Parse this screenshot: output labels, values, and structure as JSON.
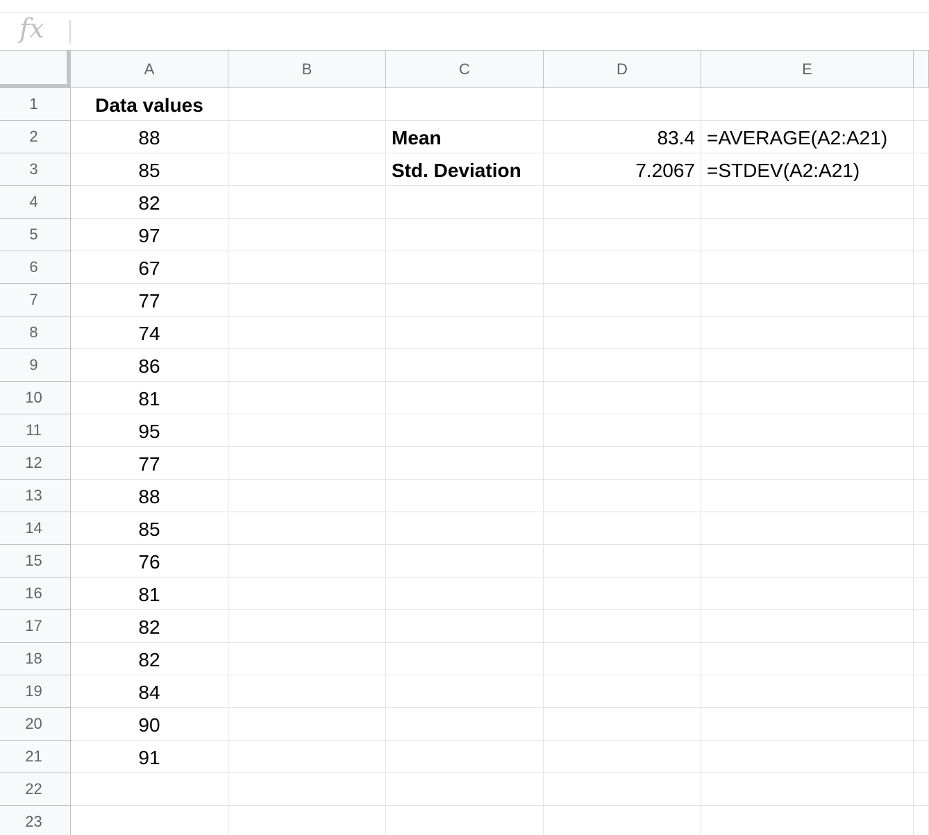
{
  "formula_bar": {
    "icon": "fx",
    "value": ""
  },
  "columns": [
    "A",
    "B",
    "C",
    "D",
    "E"
  ],
  "rows": [
    {
      "num": "1",
      "A": "Data values",
      "B": "",
      "C": "",
      "D": "",
      "E": ""
    },
    {
      "num": "2",
      "A": "88",
      "B": "",
      "C": "Mean",
      "D": "83.4",
      "E": "=AVERAGE(A2:A21)"
    },
    {
      "num": "3",
      "A": "85",
      "B": "",
      "C": "Std. Deviation",
      "D": "7.2067",
      "E": "=STDEV(A2:A21)"
    },
    {
      "num": "4",
      "A": "82",
      "B": "",
      "C": "",
      "D": "",
      "E": ""
    },
    {
      "num": "5",
      "A": "97",
      "B": "",
      "C": "",
      "D": "",
      "E": ""
    },
    {
      "num": "6",
      "A": "67",
      "B": "",
      "C": "",
      "D": "",
      "E": ""
    },
    {
      "num": "7",
      "A": "77",
      "B": "",
      "C": "",
      "D": "",
      "E": ""
    },
    {
      "num": "8",
      "A": "74",
      "B": "",
      "C": "",
      "D": "",
      "E": ""
    },
    {
      "num": "9",
      "A": "86",
      "B": "",
      "C": "",
      "D": "",
      "E": ""
    },
    {
      "num": "10",
      "A": "81",
      "B": "",
      "C": "",
      "D": "",
      "E": ""
    },
    {
      "num": "11",
      "A": "95",
      "B": "",
      "C": "",
      "D": "",
      "E": ""
    },
    {
      "num": "12",
      "A": "77",
      "B": "",
      "C": "",
      "D": "",
      "E": ""
    },
    {
      "num": "13",
      "A": "88",
      "B": "",
      "C": "",
      "D": "",
      "E": ""
    },
    {
      "num": "14",
      "A": "85",
      "B": "",
      "C": "",
      "D": "",
      "E": ""
    },
    {
      "num": "15",
      "A": "76",
      "B": "",
      "C": "",
      "D": "",
      "E": ""
    },
    {
      "num": "16",
      "A": "81",
      "B": "",
      "C": "",
      "D": "",
      "E": ""
    },
    {
      "num": "17",
      "A": "82",
      "B": "",
      "C": "",
      "D": "",
      "E": ""
    },
    {
      "num": "18",
      "A": "82",
      "B": "",
      "C": "",
      "D": "",
      "E": ""
    },
    {
      "num": "19",
      "A": "84",
      "B": "",
      "C": "",
      "D": "",
      "E": ""
    },
    {
      "num": "20",
      "A": "90",
      "B": "",
      "C": "",
      "D": "",
      "E": ""
    },
    {
      "num": "21",
      "A": "91",
      "B": "",
      "C": "",
      "D": "",
      "E": ""
    },
    {
      "num": "22",
      "A": "",
      "B": "",
      "C": "",
      "D": "",
      "E": ""
    },
    {
      "num": "23",
      "A": "",
      "B": "",
      "C": "",
      "D": "",
      "E": ""
    }
  ]
}
